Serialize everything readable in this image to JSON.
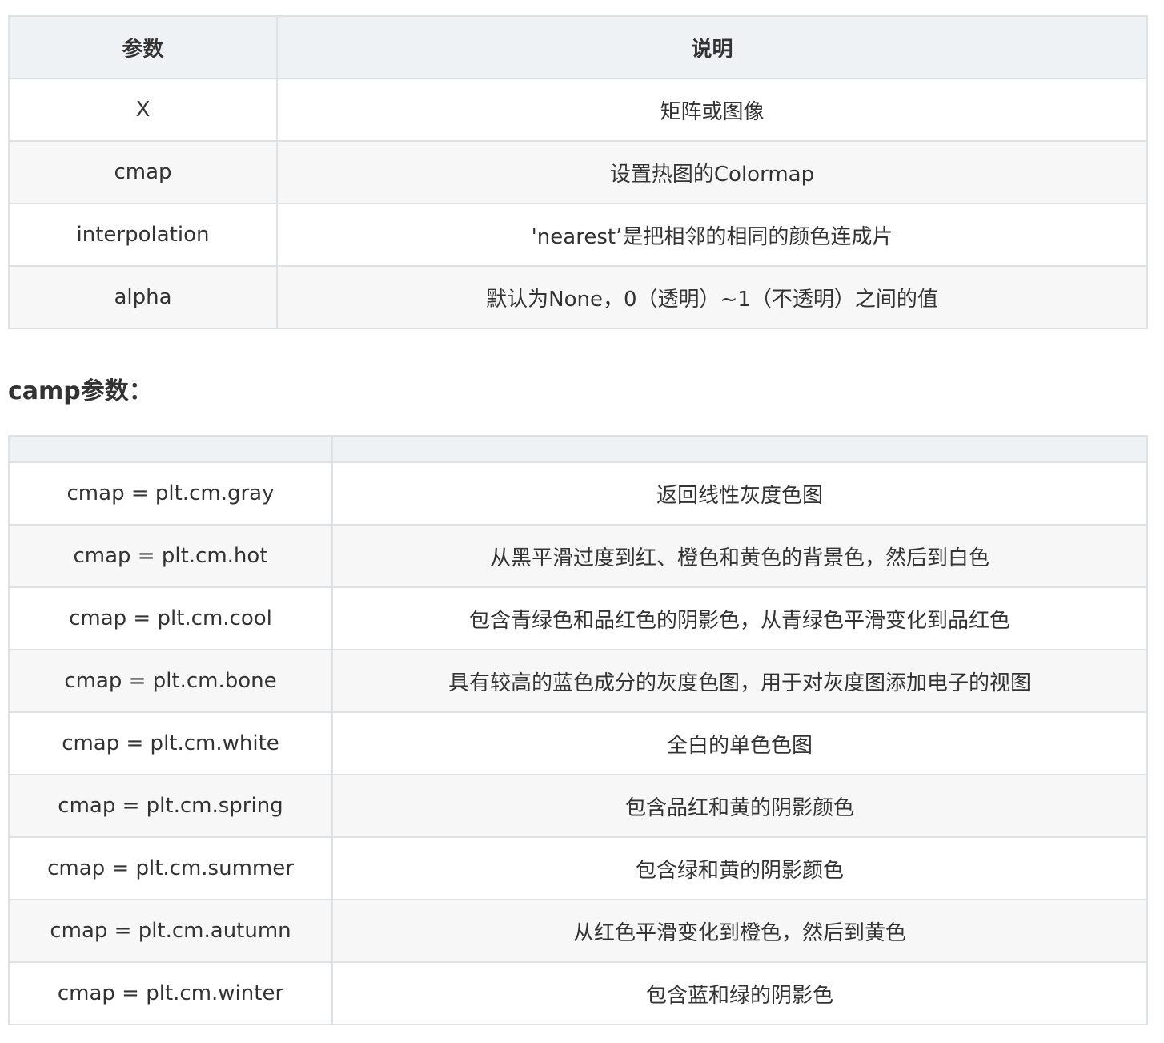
{
  "table1": {
    "headers": [
      "参数",
      "说明"
    ],
    "rows": [
      [
        "X",
        "矩阵或图像"
      ],
      [
        "cmap",
        "设置热图的Colormap"
      ],
      [
        "interpolation",
        "'nearest’是把相邻的相同的颜色连成片"
      ],
      [
        "alpha",
        "默认为None，0（透明）~1（不透明）之间的值"
      ]
    ]
  },
  "section_heading": "camp参数：",
  "table2": {
    "headers": [
      "",
      ""
    ],
    "rows": [
      [
        "cmap = plt.cm.gray",
        "返回线性灰度色图"
      ],
      [
        "cmap = plt.cm.hot",
        "从黑平滑过度到红、橙色和黄色的背景色，然后到白色"
      ],
      [
        "cmap = plt.cm.cool",
        "包含青绿色和品红色的阴影色，从青绿色平滑变化到品红色"
      ],
      [
        "cmap = plt.cm.bone",
        "具有较高的蓝色成分的灰度色图，用于对灰度图添加电子的视图"
      ],
      [
        "cmap = plt.cm.white",
        "全白的单色色图"
      ],
      [
        "cmap = plt.cm.spring",
        "包含品红和黄的阴影颜色"
      ],
      [
        "cmap = plt.cm.summer",
        "包含绿和黄的阴影颜色"
      ],
      [
        "cmap = plt.cm.autumn",
        "从红色平滑变化到橙色，然后到黄色"
      ],
      [
        "cmap = plt.cm.winter",
        "包含蓝和绿的阴影色"
      ]
    ]
  }
}
